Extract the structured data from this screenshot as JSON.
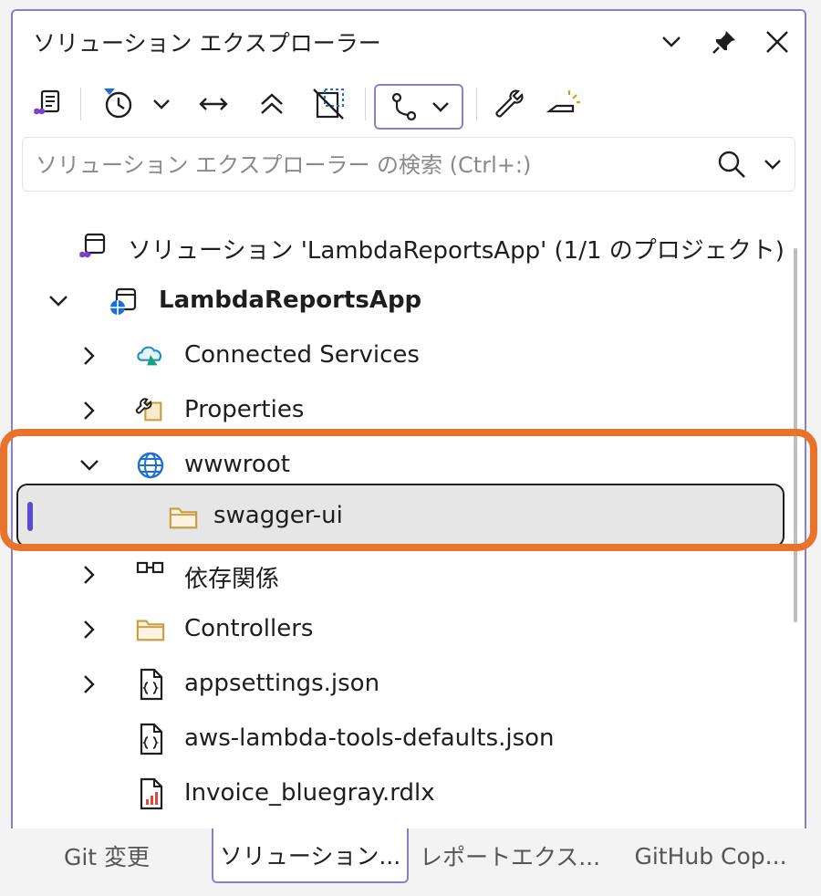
{
  "panel": {
    "title": "ソリューション エクスプローラー"
  },
  "search": {
    "placeholder": "ソリューション エクスプローラー の検索 (Ctrl+:)"
  },
  "tree": {
    "solution": "ソリューション 'LambdaReportsApp' (1/1 のプロジェクト)",
    "project": "LambdaReportsApp",
    "items": [
      {
        "label": "Connected Services",
        "icon": "connected-services-icon"
      },
      {
        "label": "Properties",
        "icon": "properties-wrench-icon"
      },
      {
        "label": "wwwroot",
        "icon": "globe-icon"
      },
      {
        "label": "swagger-ui",
        "icon": "folder-icon"
      },
      {
        "label": "依存関係",
        "icon": "dependencies-icon"
      },
      {
        "label": "Controllers",
        "icon": "folder-icon"
      },
      {
        "label": "appsettings.json",
        "icon": "json-file-icon"
      },
      {
        "label": "aws-lambda-tools-defaults.json",
        "icon": "json-file-icon"
      },
      {
        "label": "Invoice_bluegray.rdlx",
        "icon": "report-file-icon"
      }
    ]
  },
  "tabs": [
    {
      "label": "Git 変更"
    },
    {
      "label": "ソリューション..."
    },
    {
      "label": "レポートエクス..."
    },
    {
      "label": "GitHub Cop..."
    }
  ],
  "colors": {
    "accent": "#8b80c8",
    "highlight": "#e8742c",
    "selection": "#5b4bd0",
    "folder": "#c99a3e"
  }
}
